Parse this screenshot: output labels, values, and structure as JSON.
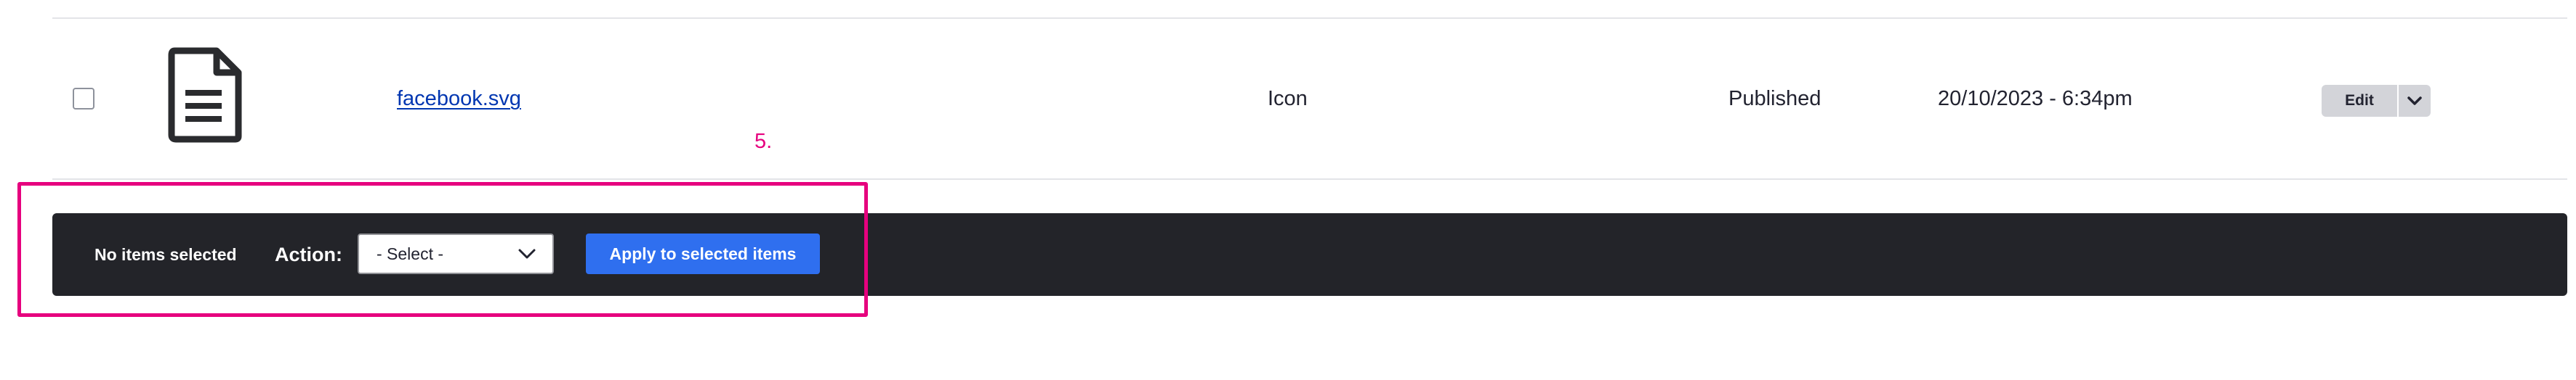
{
  "table_row": {
    "checkbox_checked": false,
    "thumbnail_icon": "document-icon",
    "filename": "facebook.svg",
    "type": "Icon",
    "status": "Published",
    "updated": "20/10/2023 - 6:34pm",
    "operations": {
      "edit_label": "Edit",
      "toggle_icon": "chevron-down-icon"
    }
  },
  "annotation": {
    "step_label": "5.",
    "color": "#e6007e"
  },
  "bulk_actions": {
    "selected_count_text": "No items selected",
    "action_label": "Action:",
    "select_value": "- Select -",
    "select_icon": "chevron-down-icon",
    "apply_label": "Apply to selected items",
    "bar_color": "#232429",
    "apply_color": "#2f6fef"
  }
}
